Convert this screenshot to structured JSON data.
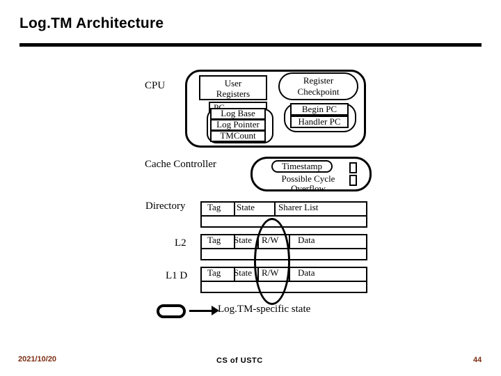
{
  "slide": {
    "title": "Log.TM Architecture",
    "footer": {
      "date": "2021/10/20",
      "center": "CS of USTC",
      "page": "44"
    }
  },
  "diagram": {
    "row_labels": {
      "cpu": "CPU",
      "cache_controller": "Cache Controller",
      "directory": "Directory",
      "l2": "L2",
      "l1d": "L1 D"
    },
    "cpu_block": {
      "user_registers": "User\nRegisters",
      "user_registers_line1": "User",
      "user_registers_line2": "Registers",
      "register_checkpoint_line1": "Register",
      "register_checkpoint_line2": "Checkpoint",
      "pc": "PC",
      "log_base": "Log Base",
      "log_pointer": "Log Pointer",
      "tm_count": "TMCount",
      "begin_pc": "Begin PC",
      "handler_pc": "Handler PC"
    },
    "cache_controller_block": {
      "timestamp": "Timestamp",
      "possible_cycle_line1": "Possible  Cycle",
      "possible_cycle_line2": "Overflow"
    },
    "directory_table": {
      "headers": [
        "Tag",
        "State",
        "Sharer List"
      ]
    },
    "l2_table": {
      "headers": [
        "Tag",
        "State",
        "R/W",
        "Data"
      ]
    },
    "l1d_table": {
      "headers": [
        "Tag",
        "State",
        "R/W",
        "Data"
      ]
    },
    "legend": {
      "text": "Log.TM-specific state"
    }
  }
}
